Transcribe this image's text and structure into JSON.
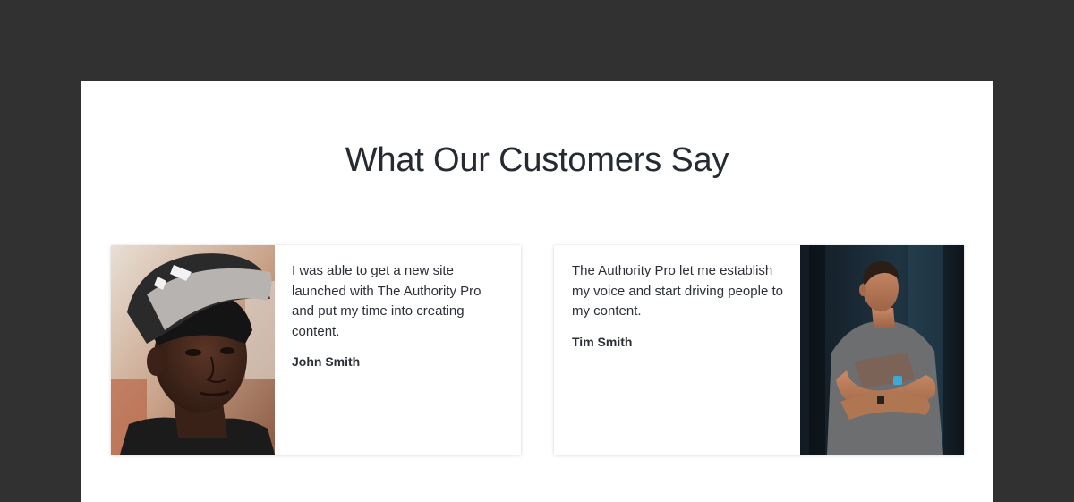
{
  "section": {
    "title": "What Our Customers Say"
  },
  "testimonials": [
    {
      "quote": "I was able to get a new site launched with The Authority Pro and put my time into creating content.",
      "author": "John Smith",
      "photo_icon": "portrait-young-man-cap"
    },
    {
      "quote": "The Authority Pro let me establish my voice and start driving people to my content.",
      "author": "Tim Smith",
      "photo_icon": "portrait-man-arms-crossed"
    }
  ],
  "colors": {
    "page_background": "#313131",
    "panel_background": "#ffffff",
    "heading_text": "#262b33",
    "body_text": "#2b2f36"
  }
}
